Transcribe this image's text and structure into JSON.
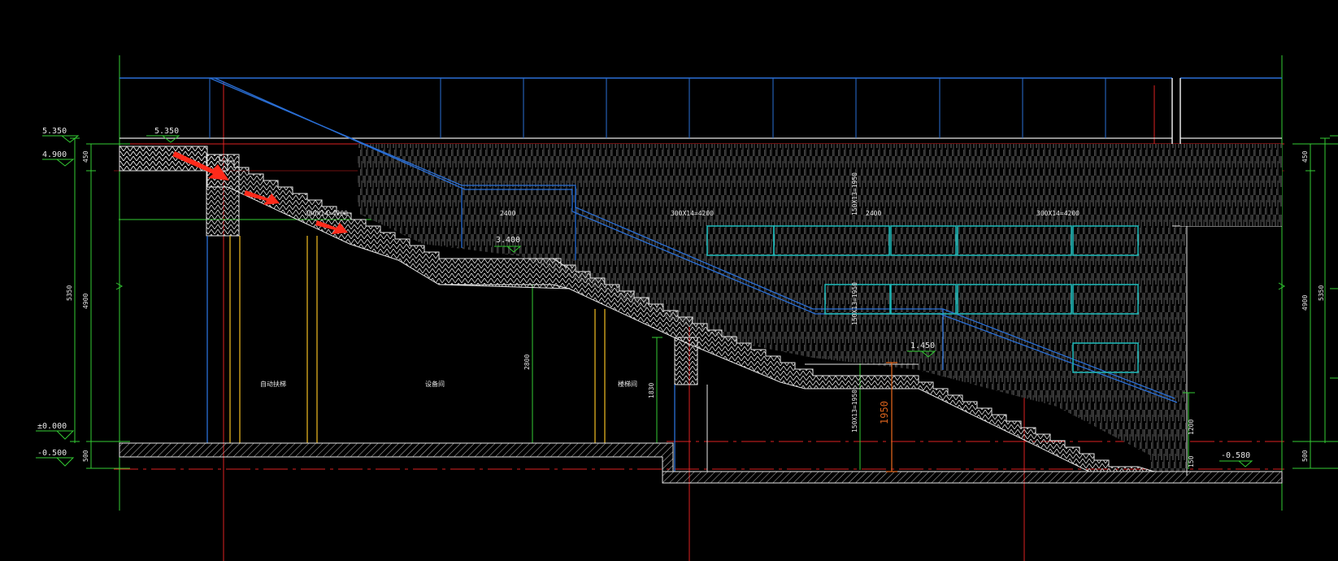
{
  "drawing": {
    "background": "#000000",
    "colors": {
      "grid_green": "#33cc33",
      "axis_red": "#dd2222",
      "blue_line": "#2a6fd6",
      "cyan": "#1fb3b3",
      "orange": "#d9621c",
      "yellow": "#e0b020",
      "white": "#e6e6e6",
      "arrow": "#ff2a1a"
    },
    "elevations": {
      "left_top": "5.350",
      "left_floor": "4.900",
      "landing_top": "5.350",
      "ground": "±0.000",
      "left_basement": "-0.500",
      "mid_landing": "3.400",
      "lower_landing": "1.450",
      "right_basement": "-0.580"
    },
    "left_dims": {
      "top": "450",
      "total": "5350",
      "mid": "4900",
      "bottom": "500"
    },
    "right_dims": {
      "top": "450",
      "total": "5350",
      "mid": "4900",
      "bottom": "500"
    },
    "stair_labels": {
      "upper_run": "300X14=4200",
      "mid_landing_w": "2400",
      "right_run": "300X14=4200",
      "right_landing_w": "2400",
      "right_run2": "300X14=4200",
      "vert_upper": "150X13=1950",
      "vert_mid": "150X13=1950",
      "vert_lower": "150X13=1950",
      "gap": "1950",
      "dim_2800": "2800",
      "dim_1830": "1830",
      "dim_1200": "1200",
      "dim_150": "150"
    },
    "room_labels": {
      "room1": "自动扶梯",
      "room2": "设备间",
      "room3": "楼梯间"
    }
  }
}
